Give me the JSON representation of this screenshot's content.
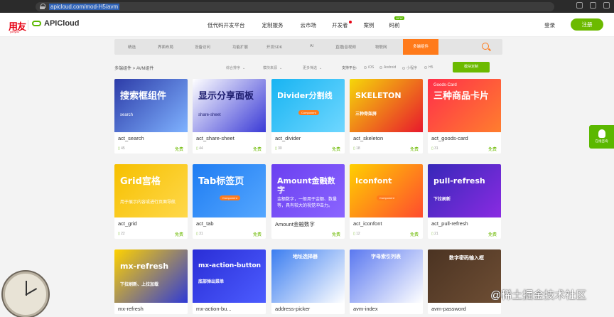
{
  "browser": {
    "url": "apicloud.com/mod-H5/avm"
  },
  "header": {
    "logo_yy": "用友",
    "logo_sub": "yonyou",
    "logo_api": "APICloud",
    "nav": [
      "低代码开发平台",
      "定制服务",
      "云市场",
      "开发者",
      "案例",
      "码前"
    ],
    "nav_badge": "NEW",
    "login": "登录",
    "register": "注册"
  },
  "categories": [
    "精选",
    "界面布局",
    "设备访问",
    "功能扩展",
    "开发SDK",
    "AI",
    "直播|音视频",
    "物联网"
  ],
  "active_category": "多端组件",
  "breadcrumb": "多端组件 > AVM组件",
  "filters": [
    "综合排序",
    "模块来源",
    "更多筛选"
  ],
  "platforms": {
    "label": "支持平台:",
    "options": [
      "iOS",
      "Android",
      "小程序",
      "H5"
    ]
  },
  "custom_button": "模块定制",
  "cards": [
    {
      "name": "act_search",
      "views": "45",
      "price": "免费",
      "title": "搜索框组件",
      "sub": "search",
      "colors": [
        "#2d3ca8",
        "#7fb2ff"
      ]
    },
    {
      "name": "act_share-sheet",
      "views": "44",
      "price": "免费",
      "title": "显示分享面板",
      "sub": "share-sheet",
      "colors": [
        "#ffffff",
        "#3a3ad6"
      ]
    },
    {
      "name": "act_divider",
      "views": "30",
      "price": "免费",
      "title": "Divider分割线",
      "sub": "",
      "colors": [
        "#18b4f2",
        "#6fd7ff"
      ]
    },
    {
      "name": "act_skeleton",
      "views": "18",
      "price": "免费",
      "title": "SKELETON",
      "sub": "三种骨架屏",
      "colors": [
        "#f5d70a",
        "#e8192c"
      ]
    },
    {
      "name": "act_goods-card",
      "views": "31",
      "price": "免费",
      "title": "三种商品卡片",
      "sub": "Goods-Card",
      "colors": [
        "#ff2f4a",
        "#ff7e2e"
      ]
    },
    {
      "name": "act_grid",
      "views": "22",
      "price": "免费",
      "title": "Grid宫格",
      "sub": "用于展示内容或进行页面导航",
      "colors": [
        "#f6c000",
        "#ffd84a"
      ]
    },
    {
      "name": "act_tab",
      "views": "31",
      "price": "免费",
      "title": "Tab标签页",
      "sub": "",
      "colors": [
        "#1e7cf2",
        "#55a7ff"
      ]
    },
    {
      "name": "Amount金融数字",
      "views": "",
      "price": "免费",
      "title": "Amount金融数字",
      "sub": "金额数字，一般用于金额、数量等，具有较大的视觉冲击力。",
      "colors": [
        "#6a3ff0",
        "#8b65ff"
      ]
    },
    {
      "name": "act_iconfont",
      "views": "12",
      "price": "免费",
      "title": "Iconfont",
      "sub": "",
      "colors": [
        "#ffd000",
        "#ff4b2e"
      ]
    },
    {
      "name": "act_pull-refresh",
      "views": "21",
      "price": "免费",
      "title": "pull-refresh",
      "sub": "下拉刷新",
      "colors": [
        "#3628b8",
        "#8a2be2"
      ]
    },
    {
      "name": "mx-refresh",
      "views": "",
      "price": "",
      "title": "mx-refresh",
      "sub": "下拉刷新、上拉加载",
      "colors": [
        "#ffd200",
        "#2f3ad6"
      ]
    },
    {
      "name": "mx-action-bu...",
      "views": "",
      "price": "",
      "title": "mx-action-button",
      "sub": "底部弹出菜单",
      "colors": [
        "#2a2ed6",
        "#4c5cff"
      ]
    },
    {
      "name": "address-picker",
      "views": "",
      "price": "",
      "title": "地址选择器",
      "sub": "",
      "colors": [
        "#3b7df0",
        "#ffffff"
      ]
    },
    {
      "name": "avm-index",
      "views": "",
      "price": "",
      "title": "字母索引列表",
      "sub": "",
      "colors": [
        "#5a78f0",
        "#ffffff"
      ]
    },
    {
      "name": "avm-password",
      "views": "",
      "price": "",
      "title": "数字密码输入框",
      "sub": "",
      "colors": [
        "#4b3322",
        "#6e4e34"
      ]
    }
  ],
  "float_widget": "在线咨询",
  "watermark": "@稀土掘金技术社区"
}
